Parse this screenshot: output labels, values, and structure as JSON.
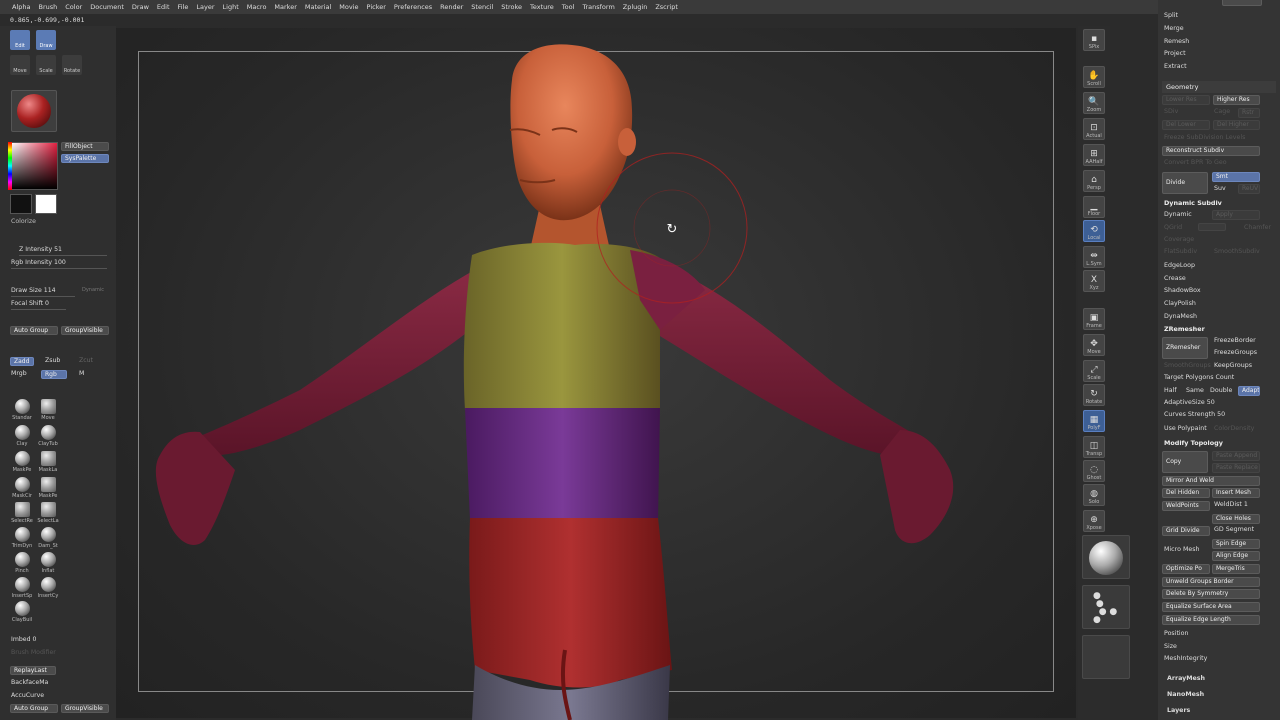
{
  "menu": [
    "Alpha",
    "Brush",
    "Color",
    "Document",
    "Draw",
    "Edit",
    "File",
    "Layer",
    "Light",
    "Macro",
    "Marker",
    "Material",
    "Movie",
    "Picker",
    "Preferences",
    "Render",
    "Stencil",
    "Stroke",
    "Texture",
    "Tool",
    "Transform",
    "Zplugin",
    "Zscript"
  ],
  "coords": "0.865,-0.699,-0.001",
  "left": {
    "tools": [
      {
        "label": "Edit",
        "active": true
      },
      {
        "label": "Draw",
        "active": true
      },
      {
        "label": "Move",
        "active": false
      },
      {
        "label": "Scale",
        "active": false
      },
      {
        "label": "Rotate",
        "active": false
      }
    ],
    "fill_object": "FillObject",
    "sys_palette": "SysPalette",
    "colorize": "Colorize",
    "z_intensity": "Z Intensity 51",
    "rgb_intensity": "Rgb Intensity 100",
    "draw_size": "Draw Size 114",
    "dynamic": "Dynamic",
    "focal_shift": "Focal Shift 0",
    "auto_group": "Auto Group",
    "group_visible": "GroupVisible",
    "zadd": "Zadd",
    "zsub": "Zsub",
    "zcut": "Zcut",
    "mrgb": "Mrgb",
    "rgb": "Rgb",
    "m": "M",
    "brushes": [
      "Standar",
      "Move",
      "Clay",
      "ClayTub",
      "MaskPe",
      "MaskLa",
      "MaskCir",
      "MaskPe",
      "SelectRe",
      "SelectLa",
      "TrimDyn",
      "Dam_St",
      "Pinch",
      "Inflat",
      "InsertSp",
      "InsertCy",
      "ClayBuil"
    ],
    "imbed": "Imbed 0",
    "brush_modifier": "Brush Modifier",
    "replay_last": "ReplayLast",
    "backface_mask": "BackfaceMa",
    "accu_curve": "AccuCurve",
    "auto_group2": "Auto Group",
    "group_visible2": "GroupVisible"
  },
  "shelf": [
    "SPix",
    "Scroll",
    "Zoom",
    "Actual",
    "AAHalf",
    "Persp",
    "Floor",
    "Local",
    "L.Sym",
    "Xyz",
    "Frame",
    "Move",
    "Scale",
    "Rotate",
    "PolyF",
    "Transp",
    "Ghost",
    "Solo",
    "Xpose"
  ],
  "right": {
    "top": [
      "Split",
      "Merge",
      "Remesh",
      "Project",
      "Extract"
    ],
    "geometry": "Geometry",
    "lower_res": "Lower Res",
    "higher_res": "Higher Res",
    "sdiv": "SDiv",
    "cage": "Cage",
    "rstr": "Rstr",
    "del_lower": "Del Lower",
    "del_higher": "Del Higher",
    "freeze_subdiv": "Freeze SubDivision Levels",
    "reconstruct": "Reconstruct Subdiv",
    "convert_bpr": "Convert BPR To Geo",
    "divide": "Divide",
    "smt": "Smt",
    "suv": "Suv",
    "reuv": "ReUV",
    "dynamic_subdiv": "Dynamic Subdiv",
    "dynamic": "Dynamic",
    "apply": "Apply",
    "qgrid": "QGrid",
    "coverage": "Coverage",
    "chamfer": "Chamfer",
    "flat_subdiv": "FlatSubdiv",
    "smooth_subdiv": "SmoothSubdiv",
    "edgeloop": "EdgeLoop",
    "crease": "Crease",
    "shadowbox": "ShadowBox",
    "claypolish": "ClayPolish",
    "dynamesh": "DynaMesh",
    "zremesher_hdr": "ZRemesher",
    "zremesher": "ZRemesher",
    "freeze_border": "FreezeBorder",
    "freeze_groups": "FreezeGroups",
    "smooth_groups": "SmoothGroups",
    "keep_groups": "KeepGroups",
    "target_polys": "Target Polygons Count",
    "half": "Half",
    "same": "Same",
    "double": "Double",
    "adapt": "Adapt",
    "adaptive_size": "AdaptiveSize 50",
    "curves_strength": "Curves Strength 50",
    "use_polypaint": "Use Polypaint",
    "color_density": "ColorDensity",
    "modify_topology": "Modify Topology",
    "copy": "Copy",
    "paste_append": "Paste Append",
    "paste_replace": "Paste Replace",
    "mirror_weld": "Mirror And Weld",
    "del_hidden": "Del Hidden",
    "insert_mesh": "Insert Mesh",
    "weld_points": "WeldPoints",
    "weld_dist": "WeldDist 1",
    "close_holes": "Close Holes",
    "grid_divide": "Grid Divide",
    "gd_segment": "GD Segment",
    "micro_mesh": "Micro Mesh",
    "spin_edge": "Spin Edge",
    "align_edge": "Align Edge",
    "optimize_points": "Optimize Po",
    "merge_tris": "MergeTris",
    "unweld_groups": "Unweld Groups Border",
    "delete_sym": "Delete By Symmetry",
    "equalize_surface": "Equalize Surface Area",
    "equalize_edge": "Equalize Edge Length",
    "position": "Position",
    "size": "Size",
    "meshintegrity": "MeshIntegrity",
    "bottom": [
      "ArrayMesh",
      "NanoMesh",
      "Layers"
    ]
  },
  "colors": {
    "accent": "#5b74a8",
    "skin": "#c8603a",
    "polypaint_red": "#9a2a2a",
    "polypaint_yellow": "#8a8a32",
    "polypaint_purple": "#6a2a8a",
    "polypaint_maroon": "#7a1e3a"
  }
}
